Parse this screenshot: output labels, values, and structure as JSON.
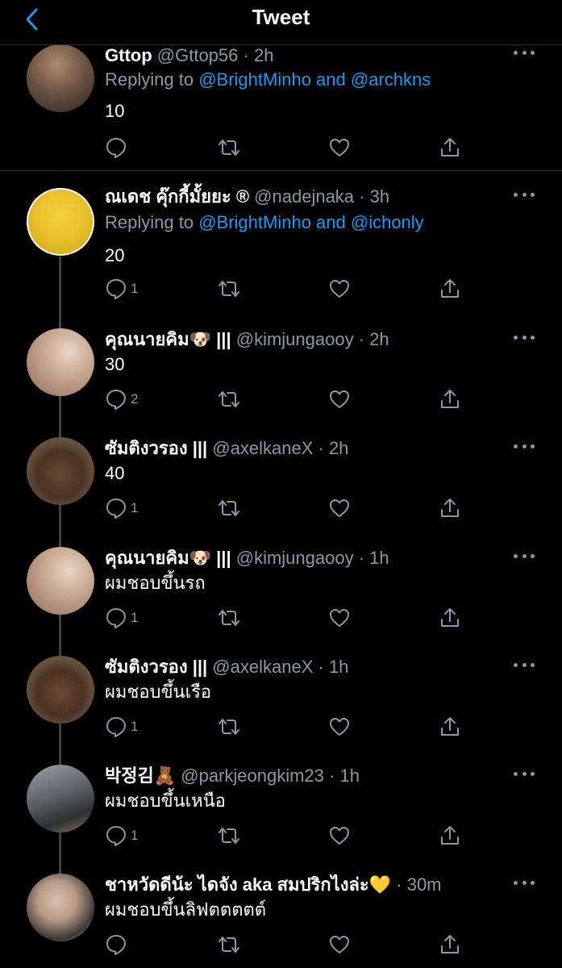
{
  "header": {
    "title": "Tweet"
  },
  "colors": {
    "accent": "#1d9bf0",
    "muted": "#8b98a5",
    "background": "#000000"
  },
  "icons": {
    "reply": "reply-icon",
    "retweet": "retweet-icon",
    "like": "heart-icon",
    "share": "share-icon",
    "more": "more-icon",
    "back": "chevron-left-icon"
  },
  "tweets": [
    {
      "name": "Gttop",
      "handle": "@Gttop56",
      "time": "· 2h",
      "replying_prefix": "Replying to",
      "replying_to": "@BrightMinho and @archkns",
      "text": "10",
      "reply_count": ""
    },
    {
      "name": "ณเดช คุ๊กกี้มั้ยยะ ®",
      "handle": "@nadejnaka",
      "time": "· 3h",
      "replying_prefix": "Replying to",
      "replying_to": "@BrightMinho and @ichonly",
      "text": "20",
      "reply_count": "1"
    },
    {
      "name": "คุณนายคิม🐶 |||",
      "handle": "@kimjungaooy",
      "time": "· 2h",
      "text": "30",
      "reply_count": "2"
    },
    {
      "name": "ซัมติงวรอง |||",
      "handle": "@axelkaneX",
      "time": "· 2h",
      "text": "40",
      "reply_count": "1"
    },
    {
      "name": "คุณนายคิม🐶 |||",
      "handle": "@kimjungaooy",
      "time": "· 1h",
      "text": "ผมชอบขึ้นรถ",
      "reply_count": "1"
    },
    {
      "name": "ซัมติงวรอง |||",
      "handle": "@axelkaneX",
      "time": "· 1h",
      "text": "ผมชอบขึ้นเรือ",
      "reply_count": "1"
    },
    {
      "name": "박정김🧸",
      "handle": "@parkjeongkim23",
      "time": "· 1h",
      "text": "ผมชอบขึ้นเหนือ",
      "reply_count": "1"
    },
    {
      "name": "ชาหวัดดีน้ะ ไดจัง aka สมปริกไงล่ะ💛",
      "handle": "",
      "time": "· 30m",
      "text": "ผมชอบขึ้นลิฟตตตตต์",
      "reply_count": ""
    }
  ]
}
